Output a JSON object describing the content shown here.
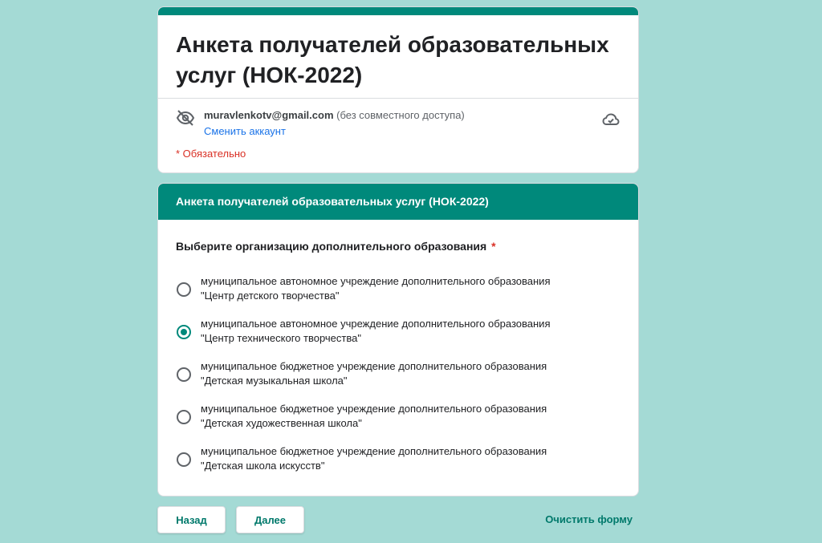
{
  "form": {
    "title": "Анкета получателей образовательных услуг (НОК-2022)",
    "account_email": "muravlenkotv@gmail.com",
    "account_sharing": "(без совместного доступа)",
    "switch_account": "Сменить аккаунт",
    "required_note": "* Обязательно"
  },
  "section": {
    "title": "Анкета получателей образовательных услуг  (НОК-2022)"
  },
  "question": {
    "label": "Выберите организацию дополнительного образования",
    "required_mark": "*",
    "options": [
      {
        "line1": "муниципальное автономное учреждение дополнительного образования",
        "line2": "\"Центр детского творчества\"",
        "selected": false
      },
      {
        "line1": "муниципальное автономное учреждение дополнительного образования",
        "line2": "\"Центр технического творчества\"",
        "selected": true
      },
      {
        "line1": "муниципальное бюджетное учреждение дополнительного образования",
        "line2": "\"Детская музыкальная школа\"",
        "selected": false
      },
      {
        "line1": "муниципальное бюджетное учреждение дополнительного образования",
        "line2": "\"Детская художественная школа\"",
        "selected": false
      },
      {
        "line1": "муниципальное бюджетное учреждение дополнительного образования",
        "line2": "\"Детская школа искусств\"",
        "selected": false
      }
    ]
  },
  "buttons": {
    "back": "Назад",
    "next": "Далее",
    "clear": "Очистить форму"
  },
  "icons": {
    "visibility": "eye-off-icon",
    "cloud": "cloud-check-icon"
  },
  "colors": {
    "background": "#a4dad5",
    "accent": "#00897b",
    "required": "#d93025",
    "link": "#1a73e8"
  }
}
